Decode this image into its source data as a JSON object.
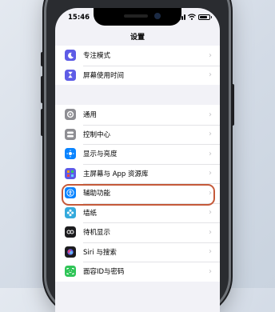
{
  "status": {
    "time": "15:46",
    "battery_level": 0.8,
    "signal_bars": 4
  },
  "nav": {
    "title": "设置"
  },
  "group1": [
    {
      "label": "专注模式",
      "icon": "moon-icon",
      "color": "#5e5ce6"
    },
    {
      "label": "屏幕使用时间",
      "icon": "hourglass-icon",
      "color": "#5e5ce6"
    }
  ],
  "group2": [
    {
      "label": "通用",
      "icon": "gear-icon",
      "color": "#8e8e93"
    },
    {
      "label": "控制中心",
      "icon": "switches-icon",
      "color": "#8e8e93"
    },
    {
      "label": "显示与亮度",
      "icon": "sun-icon",
      "color": "#0a84ff"
    },
    {
      "label": "主屏幕与 App 资源库",
      "icon": "grid-icon",
      "color": "#5e5ce6"
    },
    {
      "label": "辅助功能",
      "icon": "accessibility-icon",
      "color": "#0a84ff",
      "highlighted": true
    },
    {
      "label": "墙纸",
      "icon": "flower-icon",
      "color": "#34aadc"
    },
    {
      "label": "待机显示",
      "icon": "standby-icon",
      "color": "#1c1c1e"
    },
    {
      "label": "Siri 与搜索",
      "icon": "siri-icon",
      "color": "#1c1c1e"
    },
    {
      "label": "面容ID与密码",
      "icon": "faceid-icon",
      "color": "#30c558"
    }
  ],
  "colors": {
    "highlight": "#c55a3a",
    "background": "#f2f2f7"
  }
}
